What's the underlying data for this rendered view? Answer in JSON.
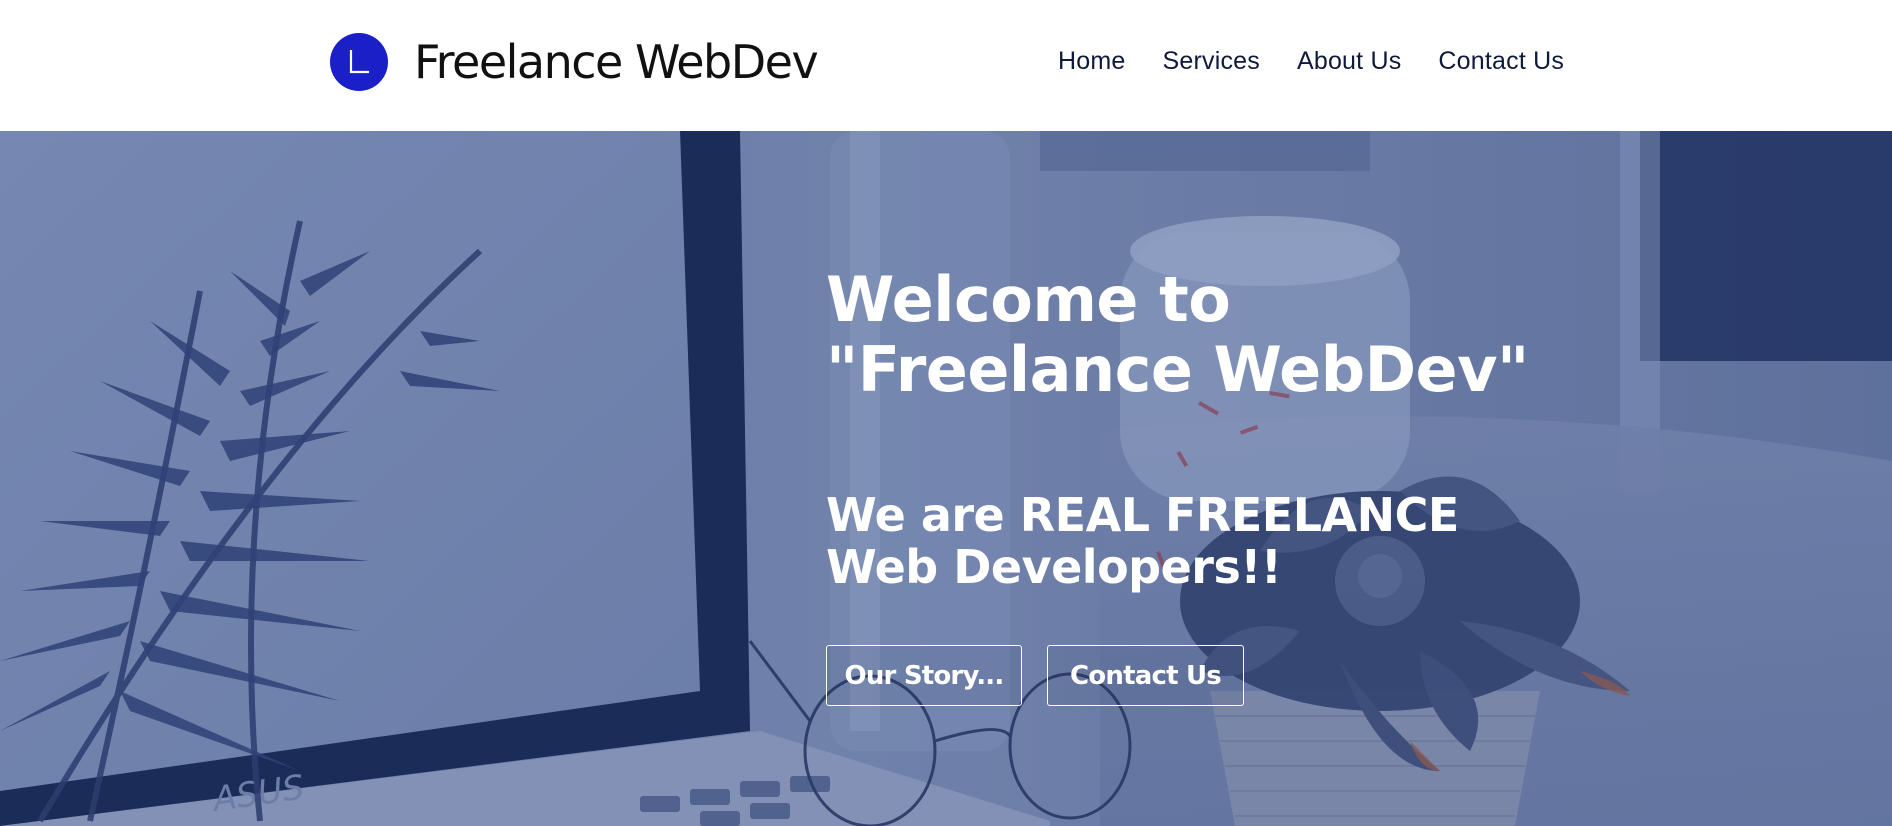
{
  "brand": {
    "logo_letter": "L",
    "name": "Freelance WebDev",
    "logo_color": "#1a1fc8"
  },
  "nav": {
    "items": [
      {
        "label": "Home"
      },
      {
        "label": "Services"
      },
      {
        "label": "About Us"
      },
      {
        "label": "Contact Us"
      }
    ]
  },
  "hero": {
    "title_line1": "Welcome to",
    "title_line2": "\"Freelance WebDev\"",
    "subtitle": "We are REAL FREELANCE Web Developers!!",
    "buttons": {
      "story_label": "Our Story...",
      "contact_label": "Contact Us"
    },
    "background_image_brand_text": "ASUS",
    "overlay_color": "#2a3f7a"
  },
  "icons": {
    "logo": "letter-l-circle-icon"
  }
}
